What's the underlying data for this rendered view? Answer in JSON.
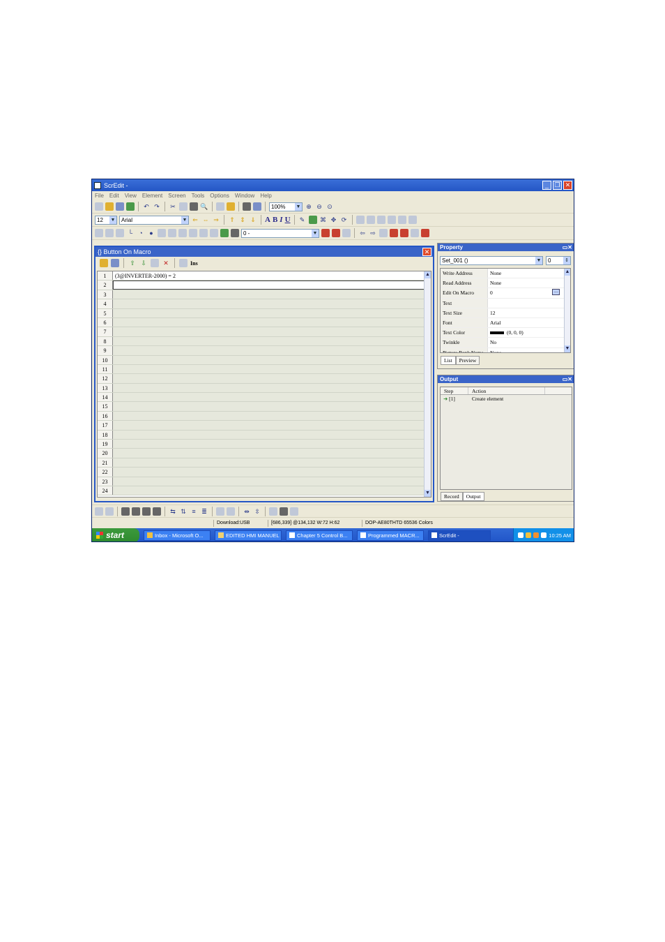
{
  "window": {
    "title": "ScrEdit -"
  },
  "menu": [
    "File",
    "Edit",
    "View",
    "Element",
    "Screen",
    "Tools",
    "Options",
    "Window",
    "Help"
  ],
  "toolbar": {
    "zoom": "100%",
    "font_size": "12",
    "font_name": "Arial",
    "layer_select": "0 -"
  },
  "macro_editor": {
    "title": "{} Button On Macro",
    "tool_ins": "Ins",
    "lines": [
      {
        "n": "1",
        "code": "(3@INVERTER-2000) = 2"
      },
      {
        "n": "2",
        "code": ""
      },
      {
        "n": "3",
        "code": ""
      },
      {
        "n": "4",
        "code": ""
      },
      {
        "n": "5",
        "code": ""
      },
      {
        "n": "6",
        "code": ""
      },
      {
        "n": "7",
        "code": ""
      },
      {
        "n": "8",
        "code": ""
      },
      {
        "n": "9",
        "code": ""
      },
      {
        "n": "10",
        "code": ""
      },
      {
        "n": "11",
        "code": ""
      },
      {
        "n": "12",
        "code": ""
      },
      {
        "n": "13",
        "code": ""
      },
      {
        "n": "14",
        "code": ""
      },
      {
        "n": "15",
        "code": ""
      },
      {
        "n": "16",
        "code": ""
      },
      {
        "n": "17",
        "code": ""
      },
      {
        "n": "18",
        "code": ""
      },
      {
        "n": "19",
        "code": ""
      },
      {
        "n": "20",
        "code": ""
      },
      {
        "n": "21",
        "code": ""
      },
      {
        "n": "22",
        "code": ""
      },
      {
        "n": "23",
        "code": ""
      },
      {
        "n": "24",
        "code": ""
      }
    ]
  },
  "property_panel": {
    "title": "Property",
    "object_select": "Set_001 ()",
    "object_index": "0",
    "rows": [
      {
        "key": "Write Address",
        "value": "None"
      },
      {
        "key": "Read Address",
        "value": "None"
      },
      {
        "key": "Edit On Macro",
        "value": "0"
      },
      {
        "key": "Text",
        "value": ""
      },
      {
        "key": "Text Size",
        "value": "12"
      },
      {
        "key": "Font",
        "value": "Arial"
      },
      {
        "key": "Text Color",
        "value": "(0, 0, 0)"
      },
      {
        "key": "Twinkle",
        "value": "No"
      },
      {
        "key": "Picture Bank Name",
        "value": "None"
      }
    ],
    "tabs": [
      "List",
      "Preview"
    ]
  },
  "output_panel": {
    "title": "Output",
    "columns": [
      "Step",
      "Action"
    ],
    "rows": [
      {
        "step": "[1]",
        "action": "Create element"
      }
    ],
    "tabs": [
      "Record",
      "Output"
    ]
  },
  "statusbar": {
    "download": "Download:USB",
    "position": "[686,339] @134,132 W:72 H:62",
    "device": "DOP-AE80THTD 65536 Colors"
  },
  "taskbar": {
    "start_label": "start",
    "tasks": [
      "Inbox - Microsoft O...",
      "EDITED HMI MANUEL",
      "Chapter 5 Control B...",
      "Programmed MACR...",
      "ScrEdit -"
    ],
    "clock": "10:25 AM"
  }
}
